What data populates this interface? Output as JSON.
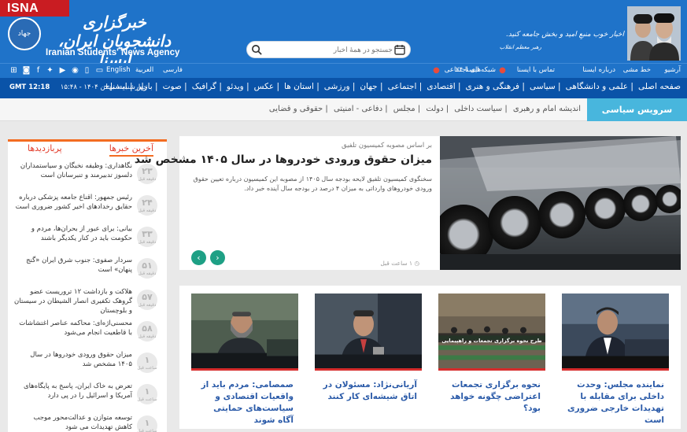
{
  "header": {
    "isna_tag": "ISNA",
    "emblem_text": "جهاد",
    "agency_name_fa": "خبرگزاری دانشجویان ایران، ایسنا",
    "agency_name_en": "Iranian Students' News Agency",
    "search_placeholder": "جستجو در همهٔ اخبار",
    "quote": "اخبار خوب منبعِ امید و بخش جامعه کنید.",
    "quote_author": "رهبر معظم انقلاب"
  },
  "top_links": {
    "archive": "آرشیو",
    "rss": "خط مشی",
    "about": "درباره ایسنا",
    "contact": "تماس با ایسنا",
    "social": "شبکه‌های اجتماعی",
    "isna24": "ایسنا ۲۴",
    "languages": [
      "فارسی",
      "العربية",
      "English"
    ]
  },
  "main_nav": {
    "items": [
      "صفحه اصلی",
      "علمی و دانشگاهی",
      "سیاسی",
      "فرهنگی و هنری",
      "اقتصادی",
      "اجتماعی",
      "جهان",
      "ورزشی",
      "استان ها",
      "عکس",
      "ویدئو",
      "گرافیک",
      "صوت",
      "بازار",
      "ایسنا+"
    ],
    "date": "چهارشنبه ۱ بهمن ۱۴۰۴ - ۱۵:۴۸",
    "gmt": "GMT 12:18"
  },
  "sub_nav": {
    "service": "سرویس سیاسی",
    "items": [
      "اندیشه امام و رهبری",
      "سیاست داخلی",
      "دولت",
      "مجلس",
      "دفاعی - امنیتی",
      "حقوقی و قضایی"
    ]
  },
  "sidebar": {
    "tab_latest": "آخرین خبرها",
    "tab_viewed": "پربازدیدها",
    "items": [
      {
        "num": "۲۳",
        "unit": "دقیقه قبل",
        "text": "نگاهداری: وظیفه نخبگان و سیاستمداران دلسوز تدبیرمند و تنبرسانان است"
      },
      {
        "num": "۲۴",
        "unit": "دقیقه قبل",
        "text": "رئیس جمهور: اقناع جامعه پزشکی درباره حقایق رخدادهای اخیر کشور ضروری است"
      },
      {
        "num": "۳۳",
        "unit": "دقیقه قبل",
        "text": "بیانی: برای عبور از بحران‌ها، مردم و حکومت باید در کنار یکدیگر باشند"
      },
      {
        "num": "۵۱",
        "unit": "دقیقه قبل",
        "text": "سردار صفوی: جنوب شرق ایران «گنج پنهان» است"
      },
      {
        "num": "۵۷",
        "unit": "دقیقه قبل",
        "text": "هلاکت و بازداشت ۱۲ تروریست عضو گروهک تکفیری انصار الشیطان در سیستان و بلوچستان"
      },
      {
        "num": "۵۸",
        "unit": "دقیقه قبل",
        "text": "محسنی‌اژه‌ای: محاکمه عناصر اغتشاشات با قاطعیت انجام می‌شود"
      },
      {
        "num": "۱",
        "unit": "ساعت قبل",
        "text": "میزان حقوق ورودی خودروها در سال ۱۴۰۵ مشخص شد"
      },
      {
        "num": "۱",
        "unit": "ساعت قبل",
        "text": "تعرض به خاک ایران، پاسخ به پایگاه‌های آمریکا و اسرائیل را در پی دارد"
      },
      {
        "num": "۱",
        "unit": "ساعت قبل",
        "text": "توسعه متوازن و عدالت‌محور موجب کاهش تهدیدات می شود"
      }
    ]
  },
  "featured": {
    "kicker": "بر اساس مصوبه کمیسیون تلفیق",
    "headline": "میزان حقوق ورودی خودروها در سال ۱۴۰۵ مشخص شد",
    "lead": "سخنگوی کمیسیون تلفیق لایحه بودجه سال ۱۴۰۵ از مصوبه این کمیسیون درباره تعیین حقوق ورودی خودروهای وارداتی به میزان ۴ درصد در بودجه سال آینده خبر داد.",
    "time": "۱ ساعت قبل"
  },
  "cards": [
    {
      "title": "نماینده مجلس: وحدت داخلی برای مقابله با تهدیدات خارجی ضروری است"
    },
    {
      "title": "نحوه برگزاری تجمعات اعتراضی چگونه خواهد بود؟",
      "image_caption": "طرح نحوه برگزاری تجمعات و راهپیمایی"
    },
    {
      "title": "آریانی‌نژاد: مسئولان در اتاق شیشه‌ای کار کنند"
    },
    {
      "title": "صمصامی: مردم باید از واقعیات اقتصادی و سیاست‌های حمایتی آگاه شوند"
    }
  ],
  "colors": {
    "header_blue": "#1f73c9",
    "nav_dark": "#0a53a8",
    "accent_red": "#c91c22",
    "service_cyan": "#48b6dd",
    "tab_orange": "#f36c21"
  }
}
